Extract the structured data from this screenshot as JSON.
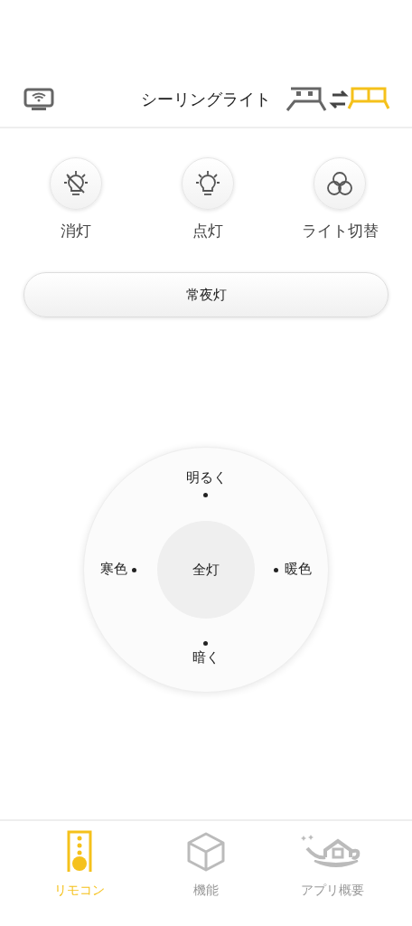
{
  "header": {
    "title": "シーリングライト"
  },
  "actions": [
    {
      "kind": "off",
      "label": "消灯"
    },
    {
      "kind": "on",
      "label": "点灯"
    },
    {
      "kind": "switch",
      "label": "ライト切替"
    }
  ],
  "night_button": "常夜灯",
  "dial": {
    "center": "全灯",
    "top": "明るく",
    "bottom": "暗く",
    "left": "寒色",
    "right": "暖色"
  },
  "tabs": [
    {
      "kind": "remote",
      "label": "リモコン",
      "selected": true
    },
    {
      "kind": "features",
      "label": "機能",
      "selected": false
    },
    {
      "kind": "about",
      "label": "アプリ概要",
      "selected": false
    }
  ]
}
